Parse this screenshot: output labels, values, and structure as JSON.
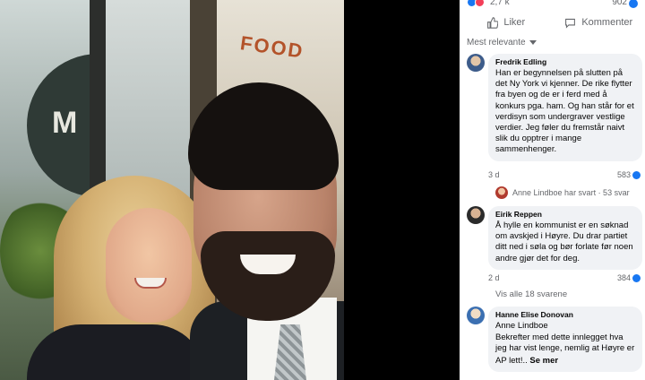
{
  "photo": {
    "awning_letter": "M",
    "store_word": "FOOD"
  },
  "panel": {
    "reaction_count": "2,7 k",
    "comment_count": "902",
    "actions": {
      "like": "Liker",
      "comment": "Kommenter"
    },
    "sort_label": "Mest relevante",
    "comments": [
      {
        "author": "Fredrik Edling",
        "text": "Han er begynnelsen på slutten på det Ny York vi kjenner. De rike flytter fra byen og de er i ferd med å konkurs pga. ham. Og han står for et verdisyn som undergraver vestlige verdier. Jeg føler du fremstår naivt slik du opptrer i mange sammenhenger.",
        "time": "3 d",
        "likes": "583",
        "reply_summary": "Anne Lindboe har svart · 53 svar"
      },
      {
        "author": "Eirik Reppen",
        "text": "Å hylle en kommunist er en søknad om avskjed i Høyre. Du drar partiet ditt ned i søla og bør forlate før noen andre gjør det for deg.",
        "time": "2 d",
        "likes": "384",
        "view_all": "Vis alle 18 svarene"
      },
      {
        "author": "Hanne Elise Donovan",
        "mention": "Anne Lindboe",
        "text": "Bekrefter med dette innlegget hva jeg har vist lenge, nemlig at Høyre er",
        "text_last": "AP lett!..",
        "see_more": "Se mer"
      }
    ]
  },
  "colors": {
    "accent": "#1877f2",
    "bubble": "#f0f2f5",
    "muted_text": "#65676b"
  }
}
